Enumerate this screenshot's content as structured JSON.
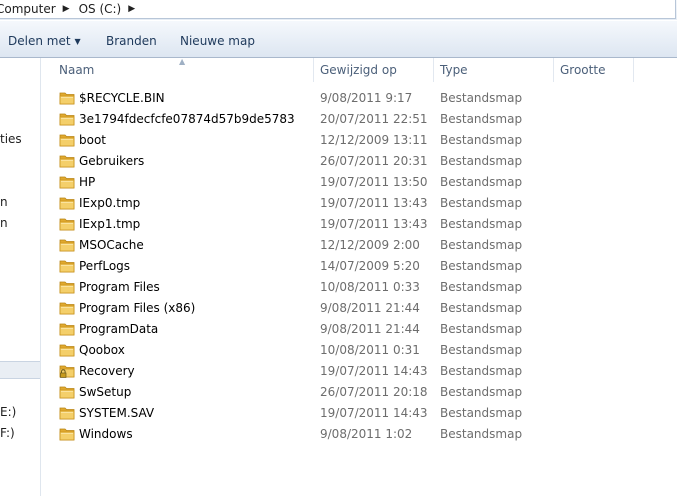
{
  "address": {
    "crumbs": [
      "Computer",
      "OS (C:)"
    ]
  },
  "toolbar": {
    "share_label": "Delen met",
    "burn_label": "Branden",
    "new_folder_label": "Nieuwe map"
  },
  "nav": {
    "items": [
      "ties",
      "n",
      "n",
      "E:)",
      "F:)"
    ]
  },
  "columns": {
    "name": "Naam",
    "modified": "Gewijzigd op",
    "type": "Type",
    "size": "Grootte"
  },
  "files": [
    {
      "name": "$RECYCLE.BIN",
      "modified": "9/08/2011 9:17",
      "type": "Bestandsmap",
      "icon": "folder-icon"
    },
    {
      "name": "3e1794fdecfcfe07874d57b9de5783",
      "modified": "20/07/2011 22:51",
      "type": "Bestandsmap",
      "icon": "folder-icon"
    },
    {
      "name": "boot",
      "modified": "12/12/2009 13:11",
      "type": "Bestandsmap",
      "icon": "folder-icon"
    },
    {
      "name": "Gebruikers",
      "modified": "26/07/2011 20:31",
      "type": "Bestandsmap",
      "icon": "folder-icon"
    },
    {
      "name": "HP",
      "modified": "19/07/2011 13:50",
      "type": "Bestandsmap",
      "icon": "folder-icon"
    },
    {
      "name": "IExp0.tmp",
      "modified": "19/07/2011 13:43",
      "type": "Bestandsmap",
      "icon": "folder-icon"
    },
    {
      "name": "IExp1.tmp",
      "modified": "19/07/2011 13:43",
      "type": "Bestandsmap",
      "icon": "folder-icon"
    },
    {
      "name": "MSOCache",
      "modified": "12/12/2009 2:00",
      "type": "Bestandsmap",
      "icon": "folder-icon"
    },
    {
      "name": "PerfLogs",
      "modified": "14/07/2009 5:20",
      "type": "Bestandsmap",
      "icon": "folder-icon"
    },
    {
      "name": "Program Files",
      "modified": "10/08/2011 0:33",
      "type": "Bestandsmap",
      "icon": "folder-icon"
    },
    {
      "name": "Program Files (x86)",
      "modified": "9/08/2011 21:44",
      "type": "Bestandsmap",
      "icon": "folder-icon"
    },
    {
      "name": "ProgramData",
      "modified": "9/08/2011 21:44",
      "type": "Bestandsmap",
      "icon": "folder-icon"
    },
    {
      "name": "Qoobox",
      "modified": "10/08/2011 0:31",
      "type": "Bestandsmap",
      "icon": "folder-icon"
    },
    {
      "name": "Recovery",
      "modified": "19/07/2011 14:43",
      "type": "Bestandsmap",
      "icon": "locked-folder-icon"
    },
    {
      "name": "SwSetup",
      "modified": "26/07/2011 20:18",
      "type": "Bestandsmap",
      "icon": "folder-icon"
    },
    {
      "name": "SYSTEM.SAV",
      "modified": "19/07/2011 14:43",
      "type": "Bestandsmap",
      "icon": "folder-icon"
    },
    {
      "name": "Windows",
      "modified": "9/08/2011 1:02",
      "type": "Bestandsmap",
      "icon": "folder-icon"
    }
  ],
  "colors": {
    "folder": "#e8b43c",
    "toolbar_text": "#1e395b",
    "header_text": "#4c607a",
    "meta_text": "#6d6d6d"
  }
}
